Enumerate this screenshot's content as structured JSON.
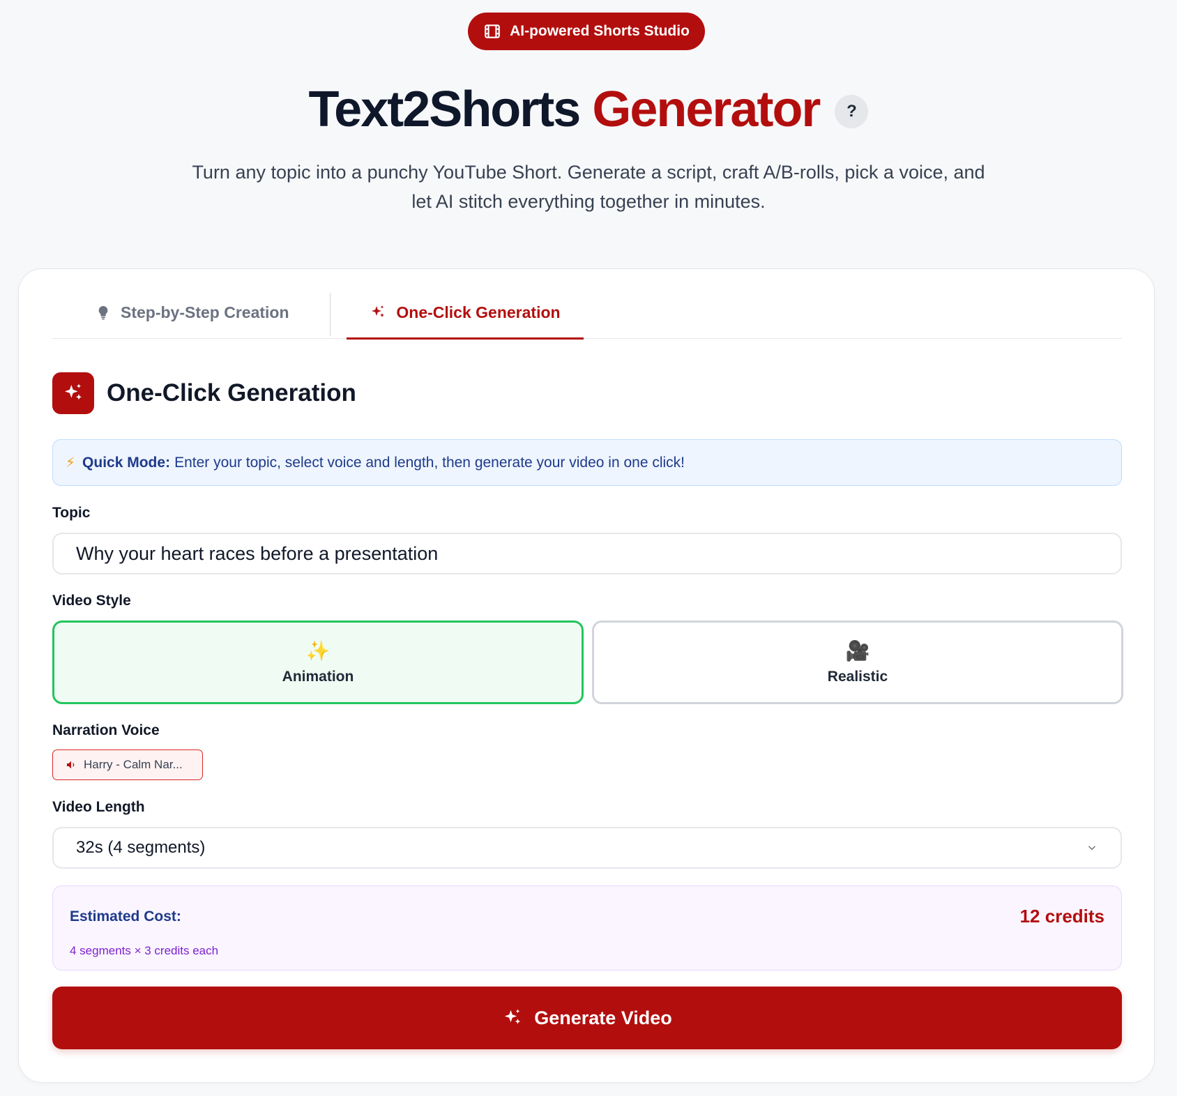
{
  "badge": {
    "label": "AI-powered Shorts Studio",
    "icon": "film-icon"
  },
  "header": {
    "title_main": "Text2Shorts",
    "title_accent": "Generator",
    "help": "?",
    "subtitle": "Turn any topic into a punchy YouTube Short. Generate a script, craft A/B-rolls, pick a voice, and let AI stitch everything together in minutes."
  },
  "tabs": [
    {
      "label": "Step-by-Step Creation",
      "icon": "lightbulb-icon",
      "active": false
    },
    {
      "label": "One-Click Generation",
      "icon": "sparkles-icon",
      "active": true
    }
  ],
  "section": {
    "title": "One-Click Generation",
    "icon": "sparkles-icon"
  },
  "quick_mode": {
    "icon": "⚡",
    "title": "Quick Mode:",
    "text": "Enter your topic, select voice and length, then generate your video in one click!"
  },
  "topic": {
    "label": "Topic",
    "value": "Why your heart races before a presentation"
  },
  "video_style": {
    "label": "Video Style",
    "options": [
      {
        "label": "Animation",
        "emoji": "✨",
        "selected": true
      },
      {
        "label": "Realistic",
        "emoji": "🎥",
        "selected": false
      }
    ]
  },
  "voice": {
    "label": "Narration Voice",
    "value": "Harry - Calm Nar...",
    "icon": "speaker-icon"
  },
  "length": {
    "label": "Video Length",
    "value": "32s (4 segments)"
  },
  "cost": {
    "label": "Estimated Cost:",
    "detail": "4 segments × 3 credits each",
    "value": "12 credits"
  },
  "generate": {
    "label": "Generate Video"
  },
  "colors": {
    "brand": "#b30e0e",
    "selected_border": "#22c55e",
    "info_bg": "#eef5ff",
    "cost_bg": "#faf5ff"
  }
}
